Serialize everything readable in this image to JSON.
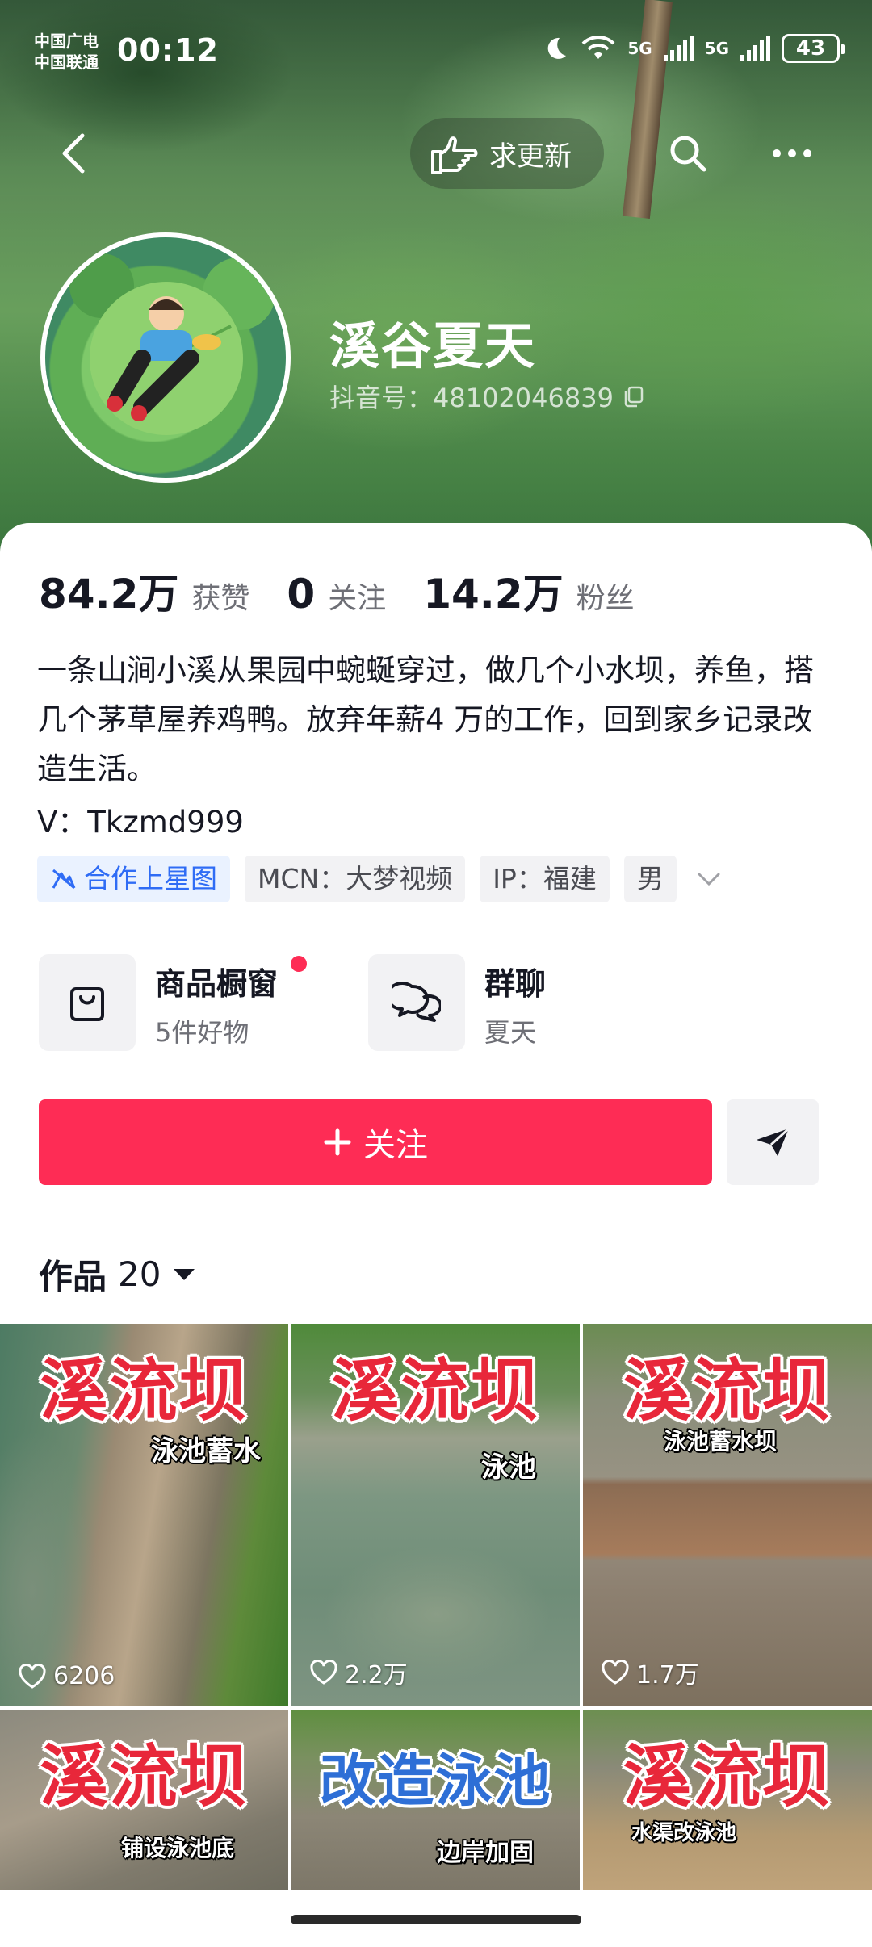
{
  "status_bar": {
    "carrier_1": "中国广电",
    "carrier_2": "中国联通",
    "time": "00:12",
    "network_1": "5G",
    "network_2": "5G",
    "battery": "43"
  },
  "nav": {
    "request_update_label": "求更新"
  },
  "profile": {
    "name": "溪谷夏天",
    "douyin_id": "抖音号：48102046839"
  },
  "stats": {
    "likes_value": "84.2万",
    "likes_label": "获赞",
    "following_value": "0",
    "following_label": "关注",
    "followers_value": "14.2万",
    "followers_label": "粉丝"
  },
  "bio": {
    "text": "一条山涧小溪从果园中蜿蜒穿过，做几个小水坝，养鱼，搭几个茅草屋养鸡鸭。放弃年薪4 万的工作，回到家乡记录改造生活。",
    "contact": "V：Tkzmd999"
  },
  "tags": {
    "cooperation": "合作上星图",
    "mcn": "MCN：大梦视频",
    "ip": "IP：福建",
    "gender": "男"
  },
  "entries": {
    "shop_title": "商品橱窗",
    "shop_sub": "5件好物",
    "group_title": "群聊",
    "group_sub": "夏天"
  },
  "actions": {
    "follow_label": "关注"
  },
  "works": {
    "label": "作品",
    "count": "20"
  },
  "videos": [
    {
      "title": "溪流坝",
      "subtitle": "泳池蓄水",
      "likes": "6206"
    },
    {
      "title": "溪流坝",
      "subtitle": "泳池",
      "likes": "2.2万"
    },
    {
      "title": "溪流坝",
      "subtitle": "泳池蓄水坝",
      "likes": "1.7万"
    },
    {
      "title": "溪流坝",
      "subtitle": "铺设泳池底",
      "likes": ""
    },
    {
      "title": "改造泳池",
      "subtitle": "边岸加固",
      "likes": ""
    },
    {
      "title": "溪流坝",
      "subtitle": "水渠改泳池",
      "likes": ""
    }
  ],
  "colors": {
    "accent": "#fe2c55",
    "tag_blue": "#2f6cf5",
    "cover_green": "#4d8a4a"
  }
}
